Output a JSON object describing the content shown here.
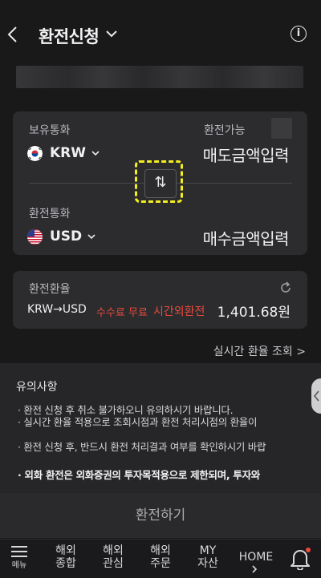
{
  "header": {
    "title": "환전신청"
  },
  "exchange": {
    "held_label": "보유통화",
    "available_label": "환전가능",
    "from_currency": "KRW",
    "sell_placeholder": "매도금액입력",
    "target_label": "환전통화",
    "to_currency": "USD",
    "buy_placeholder": "매수금액입력",
    "swap_icon": "⇅"
  },
  "rate": {
    "label": "환전환율",
    "pair": "KRW→USD",
    "fee": "수수료 무료",
    "after_hours": "시간외환전",
    "value": "1,401.68원"
  },
  "realtime_link": "실시간 환율 조회 >",
  "notice": {
    "title": "유의사항",
    "lines": [
      "· 환전 신청 후 취소 불가하오니 유의하시기 바랍니다.",
      "· 실시간 환율 적용으로 조회시점과 환전 처리시점의 환율이",
      "· 환전 신청 후, 반드시 환전 처리결과 여부를 확인하시기 바랍",
      "· 외화 환전은 외화증권의 투자목적용으로 제한되며, 투자와"
    ]
  },
  "submit_label": "환전하기",
  "nav": {
    "menu": "메뉴",
    "items": [
      {
        "line1": "해외",
        "line2": "종합"
      },
      {
        "line1": "해외",
        "line2": "관심"
      },
      {
        "line1": "해외",
        "line2": "주문"
      },
      {
        "line1": "MY",
        "line2": "자산"
      }
    ],
    "home": "HOME"
  },
  "colors": {
    "accent_red": "#e84a3c",
    "highlight": "#f3ee22",
    "notification_dot": "#e84a3c"
  }
}
